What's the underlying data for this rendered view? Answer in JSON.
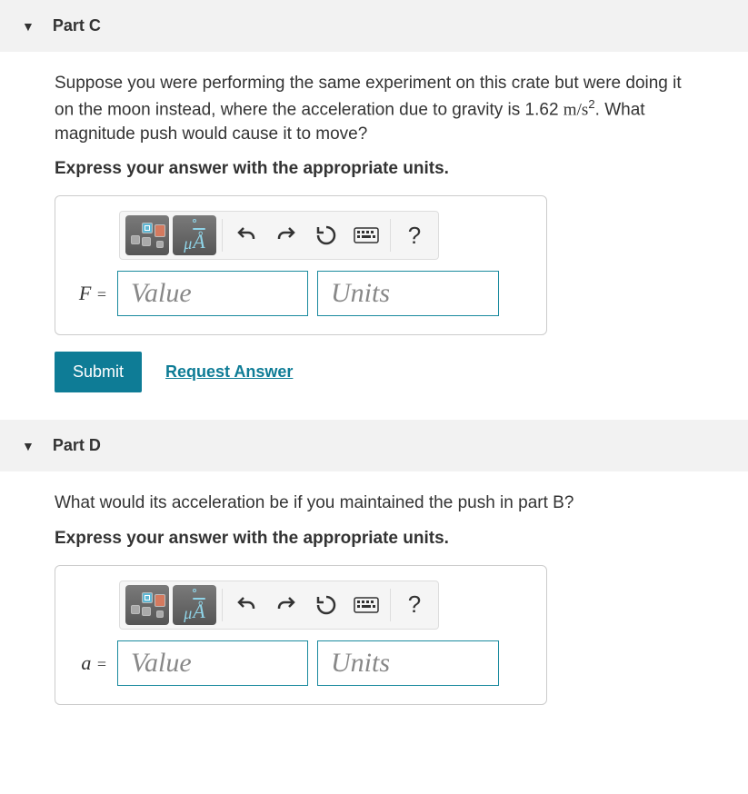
{
  "partC": {
    "title": "Part C",
    "question_pre": "Suppose you were performing the same experiment on this crate but were doing it on the moon instead, where the acceleration due to gravity is 1.62 ",
    "question_unit": "m/s",
    "question_exp": "2",
    "question_post": ". What magnitude push would cause it to move?",
    "instruction": "Express your answer with the appropriate units.",
    "variable": "F",
    "value_placeholder": "Value",
    "units_placeholder": "Units",
    "submit_label": "Submit",
    "request_label": "Request Answer"
  },
  "partD": {
    "title": "Part D",
    "question": "What would its acceleration be if you maintained the push in part B?",
    "instruction": "Express your answer with the appropriate units.",
    "variable": "a",
    "value_placeholder": "Value",
    "units_placeholder": "Units"
  },
  "toolbar": {
    "templates_title": "Templates",
    "symbols_title": "Symbols",
    "undo_title": "Undo",
    "redo_title": "Redo",
    "reset_title": "Reset",
    "keyboard_title": "Keyboard",
    "help_title": "Help"
  }
}
